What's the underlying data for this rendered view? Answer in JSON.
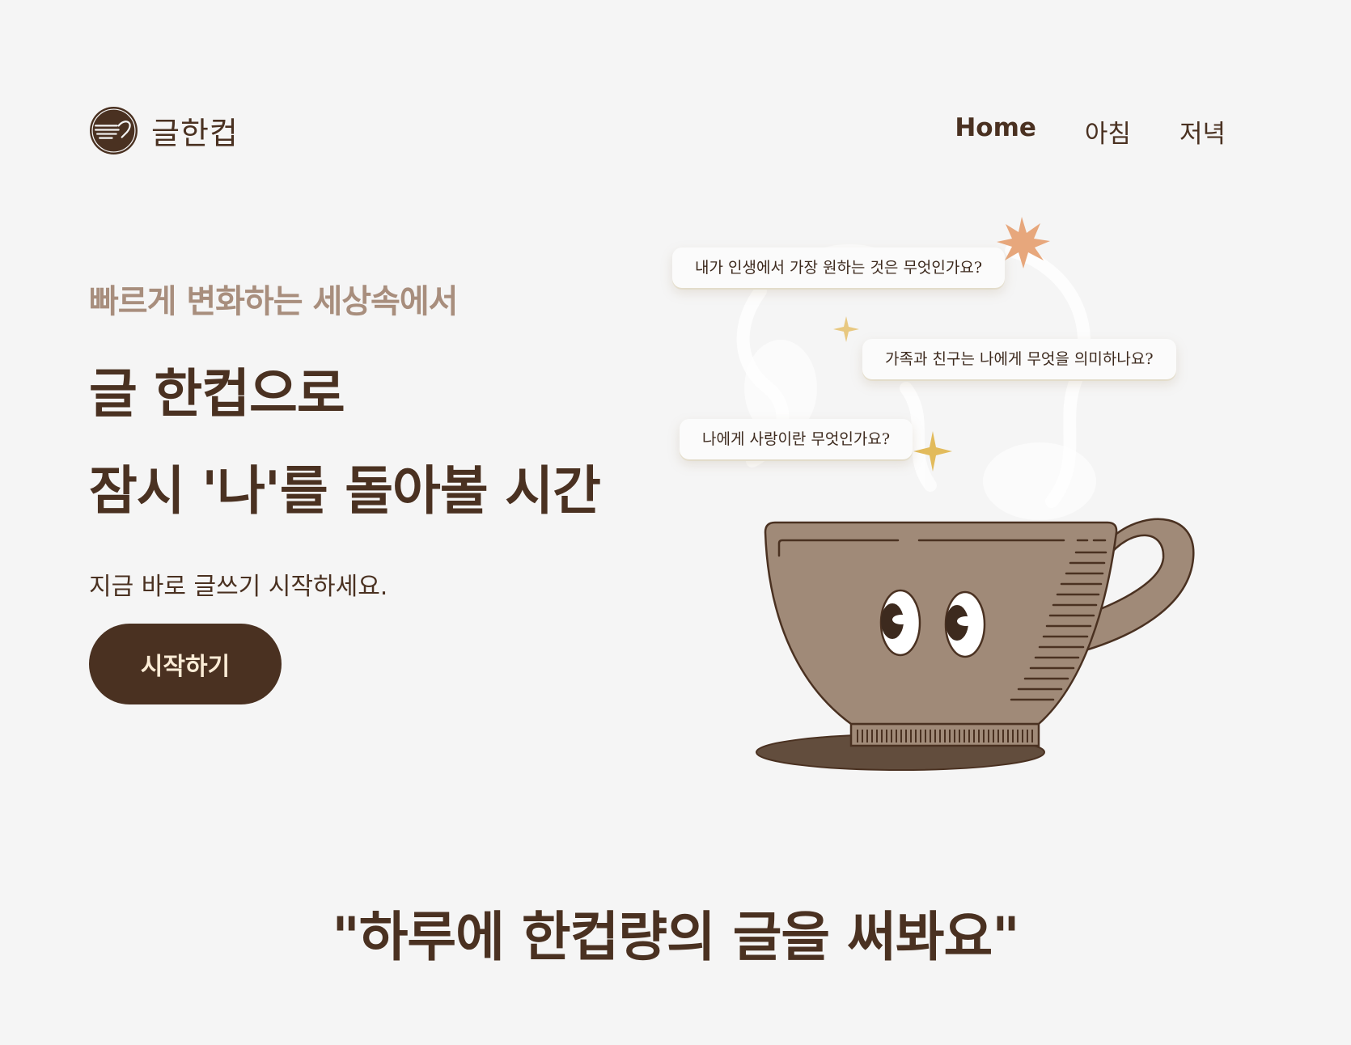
{
  "header": {
    "logo_text": "글한컵",
    "nav": [
      {
        "label": "Home",
        "active": true
      },
      {
        "label": "아침",
        "active": false
      },
      {
        "label": "저녁",
        "active": false
      }
    ]
  },
  "hero": {
    "tagline": "빠르게 변화하는 세상속에서",
    "headline_line1": "글 한컵으로",
    "headline_line2": "잠시 '나'를 돌아볼 시간",
    "subline": "지금 바로 글쓰기 시작하세요.",
    "cta_label": "시작하기"
  },
  "illustration": {
    "bubbles": [
      "내가 인생에서 가장 원하는 것은 무엇인가요?",
      "가족과 친구는 나에게 무엇을 의미하나요?",
      "나에게 사랑이란 무엇인가요?"
    ]
  },
  "quote": "\"하루에 한컵량의 글을 써봐요\"",
  "colors": {
    "background": "#f5f5f5",
    "brand_dark": "#4a3121",
    "tagline": "#a88e7d",
    "cup": "#a08a78",
    "saucer": "#624d3d",
    "star_orange": "#e7a77c",
    "star_gold": "#e2bb5c"
  }
}
